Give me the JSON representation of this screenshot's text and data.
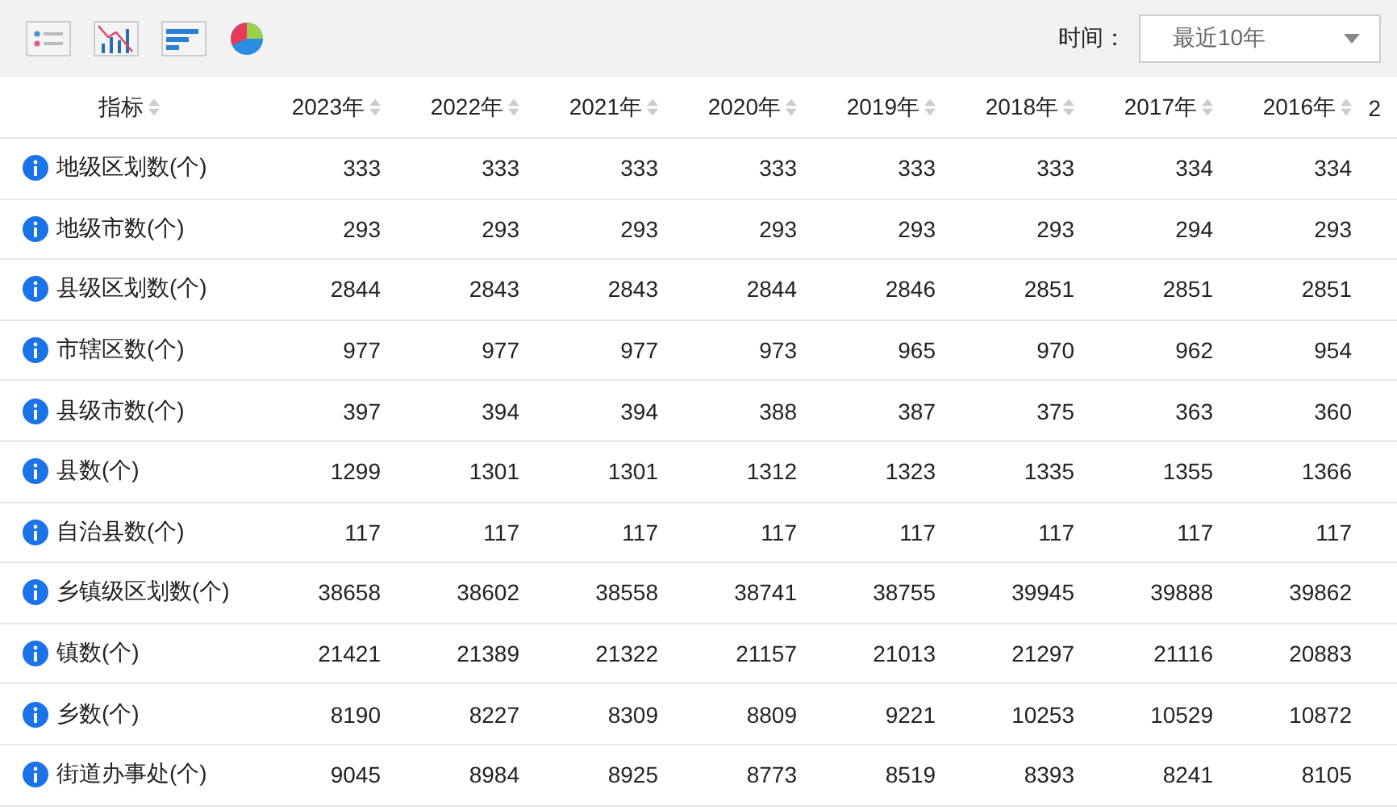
{
  "toolbar": {
    "time_label": "时间：",
    "time_select": {
      "value": "最近10年"
    }
  },
  "table": {
    "columns": [
      "指标",
      "2023年",
      "2022年",
      "2021年",
      "2020年",
      "2019年",
      "2018年",
      "2017年",
      "2016年",
      "2"
    ],
    "rows": [
      {
        "name": "地级区划数(个)",
        "values": [
          "333",
          "333",
          "333",
          "333",
          "333",
          "333",
          "334",
          "334"
        ]
      },
      {
        "name": "地级市数(个)",
        "values": [
          "293",
          "293",
          "293",
          "293",
          "293",
          "293",
          "294",
          "293"
        ]
      },
      {
        "name": "县级区划数(个)",
        "values": [
          "2844",
          "2843",
          "2843",
          "2844",
          "2846",
          "2851",
          "2851",
          "2851"
        ]
      },
      {
        "name": "市辖区数(个)",
        "values": [
          "977",
          "977",
          "977",
          "973",
          "965",
          "970",
          "962",
          "954"
        ]
      },
      {
        "name": "县级市数(个)",
        "values": [
          "397",
          "394",
          "394",
          "388",
          "387",
          "375",
          "363",
          "360"
        ]
      },
      {
        "name": "县数(个)",
        "values": [
          "1299",
          "1301",
          "1301",
          "1312",
          "1323",
          "1335",
          "1355",
          "1366"
        ]
      },
      {
        "name": "自治县数(个)",
        "values": [
          "117",
          "117",
          "117",
          "117",
          "117",
          "117",
          "117",
          "117"
        ]
      },
      {
        "name": "乡镇级区划数(个)",
        "values": [
          "38658",
          "38602",
          "38558",
          "38741",
          "38755",
          "39945",
          "39888",
          "39862"
        ]
      },
      {
        "name": "镇数(个)",
        "values": [
          "21421",
          "21389",
          "21322",
          "21157",
          "21013",
          "21297",
          "21116",
          "20883"
        ]
      },
      {
        "name": "乡数(个)",
        "values": [
          "8190",
          "8227",
          "8309",
          "8809",
          "9221",
          "10253",
          "10529",
          "10872"
        ]
      },
      {
        "name": "街道办事处(个)",
        "values": [
          "9045",
          "8984",
          "8925",
          "8773",
          "8519",
          "8393",
          "8241",
          "8105"
        ]
      }
    ]
  }
}
